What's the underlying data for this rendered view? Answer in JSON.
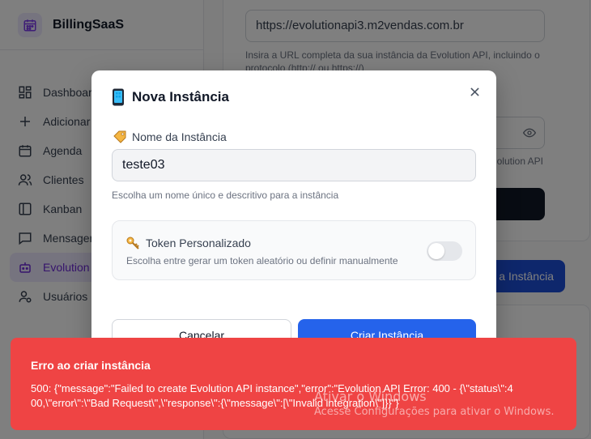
{
  "sidebar": {
    "brand": "BillingSaaS",
    "items": [
      {
        "label": "Dashboard",
        "icon": "dashboard-icon"
      },
      {
        "label": "Adicionar",
        "icon": "plus-icon"
      },
      {
        "label": "Agenda",
        "icon": "calendar-icon"
      },
      {
        "label": "Clientes",
        "icon": "users-icon"
      },
      {
        "label": "Kanban",
        "icon": "kanban-icon"
      },
      {
        "label": "Mensagens",
        "icon": "message-icon"
      },
      {
        "label": "Evolution",
        "icon": "bot-icon"
      },
      {
        "label": "Usuários",
        "icon": "user-settings-icon"
      }
    ]
  },
  "settings": {
    "api_url": "https://evolutionapi3.m2vendas.com.br",
    "api_url_help": "Insira a URL completa da sua instância da Evolution API, incluindo o protocolo (http:// ou https://)",
    "token_help_fragment": "olution API",
    "new_instance_fragment": "a Instância"
  },
  "modal": {
    "title": "Nova Instância",
    "name_label": "Nome da Instância",
    "name_value": "teste03",
    "name_help": "Escolha um nome único e descritivo para a instância",
    "token_title": "Token Personalizado",
    "token_desc": "Escolha entre gerar um token aleatório ou definir manualmente",
    "token_toggle_on": false,
    "cancel_label": "Cancelar",
    "create_label": "Criar Instância"
  },
  "toast": {
    "title": "Erro ao criar instância",
    "message": "500: {\"message\":\"Failed to create Evolution API instance\",\"error\":\"Evolution API Error: 400 - {\\\"status\\\":400,\\\"error\\\":\\\"Bad Request\\\",\\\"response\\\":{\\\"message\\\":[\\\"Invalid integration\\\"]}}\"}"
  },
  "watermark": {
    "line1": "Ativar o Windows",
    "line2": "Acesse Configurações para ativar o Windows."
  },
  "colors": {
    "accent": "#2563eb",
    "error": "#ef4444",
    "brand_bg": "#ede9fe",
    "brand_fg": "#7c3aed"
  }
}
